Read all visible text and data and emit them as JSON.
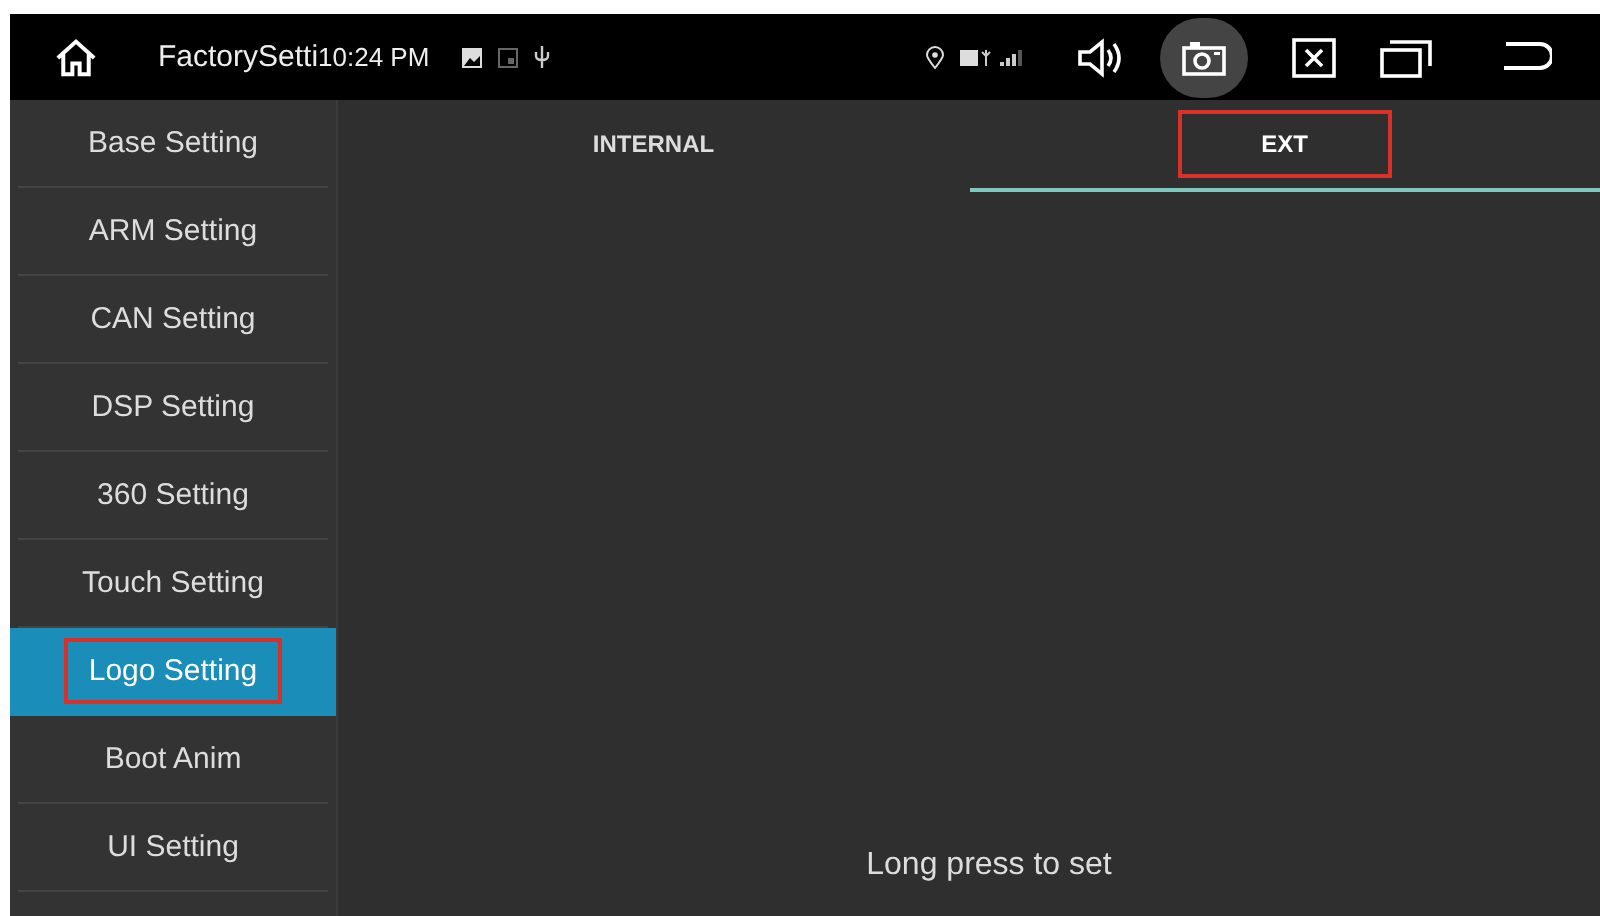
{
  "status_bar": {
    "app_title": "FactorySetti",
    "time": "10:24 PM"
  },
  "sidebar": {
    "items": [
      {
        "label": "Base Setting",
        "selected": false,
        "highlighted": false
      },
      {
        "label": "ARM Setting",
        "selected": false,
        "highlighted": false
      },
      {
        "label": "CAN Setting",
        "selected": false,
        "highlighted": false
      },
      {
        "label": "DSP Setting",
        "selected": false,
        "highlighted": false
      },
      {
        "label": "360 Setting",
        "selected": false,
        "highlighted": false
      },
      {
        "label": "Touch Setting",
        "selected": false,
        "highlighted": false
      },
      {
        "label": "Logo Setting",
        "selected": true,
        "highlighted": true
      },
      {
        "label": "Boot Anim",
        "selected": false,
        "highlighted": false
      },
      {
        "label": "UI Setting",
        "selected": false,
        "highlighted": false
      }
    ]
  },
  "tabs": [
    {
      "label": "INTERNAL",
      "selected": false,
      "highlighted": false
    },
    {
      "label": "EXT",
      "selected": true,
      "highlighted": true
    }
  ],
  "hint": "Long press to set"
}
